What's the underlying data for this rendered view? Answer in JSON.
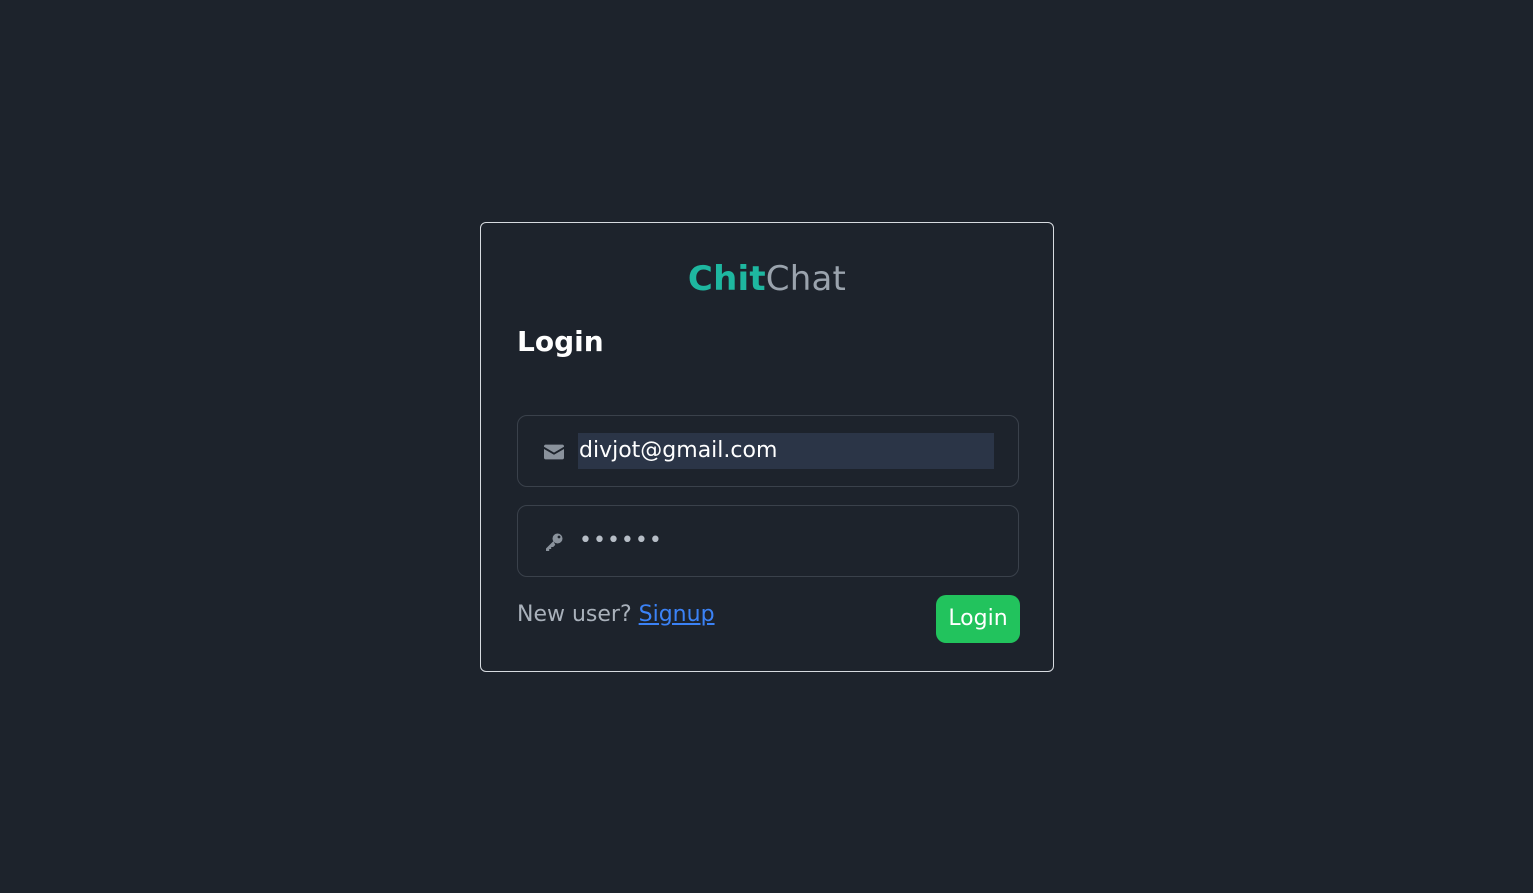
{
  "brand": {
    "part1": "Chit",
    "part2": "Chat"
  },
  "form": {
    "title": "Login",
    "email": {
      "value": "divjot@gmail.com",
      "icon": "envelope-icon"
    },
    "password": {
      "value": "••••••",
      "icon": "key-icon"
    },
    "footer": {
      "prompt": "New user?",
      "link": "Signup"
    },
    "submit_label": "Login"
  },
  "colors": {
    "background": "#1d232c",
    "brand_accent": "#1eb7a0",
    "brand_muted": "#9aa3ad",
    "link": "#3b82f6",
    "button": "#22c35d",
    "autofill_bg": "#2b3547"
  }
}
